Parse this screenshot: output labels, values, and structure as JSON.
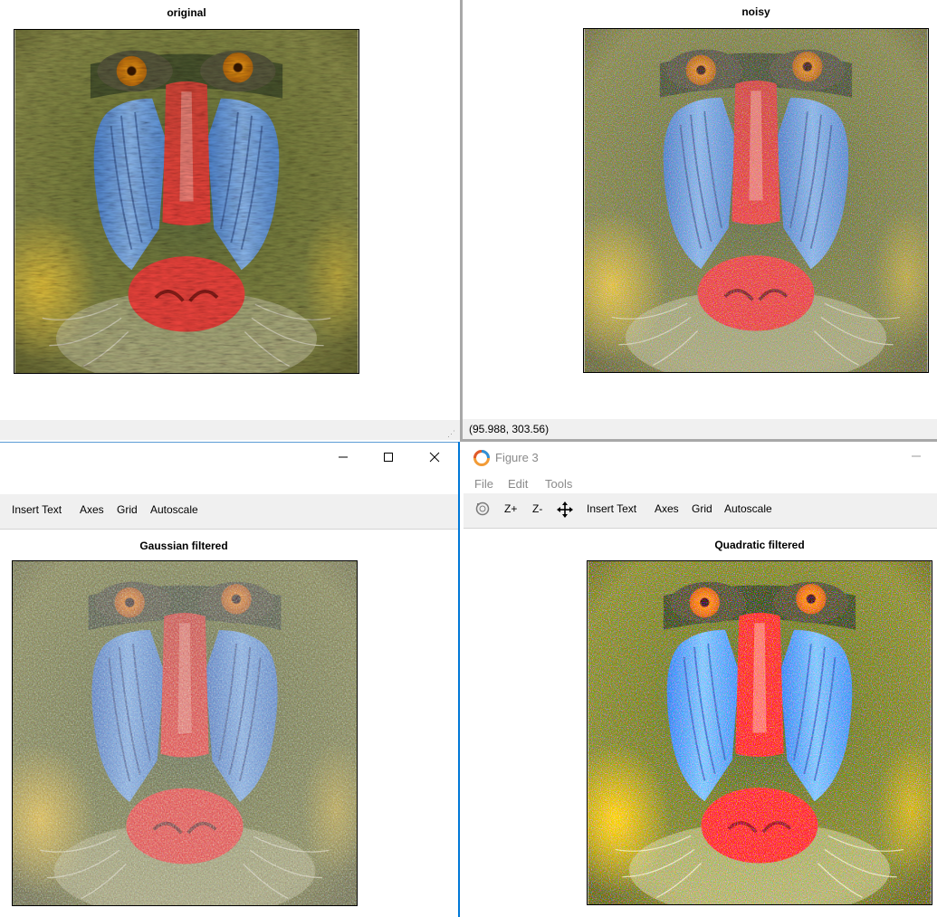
{
  "panes": {
    "top_left": {
      "title": "original"
    },
    "top_right": {
      "title": "noisy",
      "status_coords": "(95.988, 303.56)"
    },
    "bottom_left": {
      "title": "Gaussian filtered",
      "toolbar": [
        "Insert Text",
        "Axes",
        "Grid",
        "Autoscale"
      ]
    },
    "bottom_right": {
      "window_title": "Figure 3",
      "menu": [
        "File",
        "Edit",
        "Tools"
      ],
      "toolbar": {
        "zoom_in": "Z+",
        "zoom_out": "Z-",
        "items": [
          "Insert Text",
          "Axes",
          "Grid",
          "Autoscale"
        ]
      },
      "title": "Quadratic filtered"
    }
  },
  "icons": {
    "app": "octave-figure-icon",
    "minimize": "minimize-icon",
    "maximize": "maximize-icon",
    "close": "close-icon",
    "rotate": "rotate-icon",
    "pan": "pan-icon"
  },
  "colors": {
    "window_accent": "#0078d7",
    "toolbar_bg": "#f0f0f0",
    "nose_red": "#e8403a",
    "cheek_blue": "#6aa2e6",
    "eye_orange": "#e08a14",
    "fur_olive": "#7a7c3a"
  }
}
